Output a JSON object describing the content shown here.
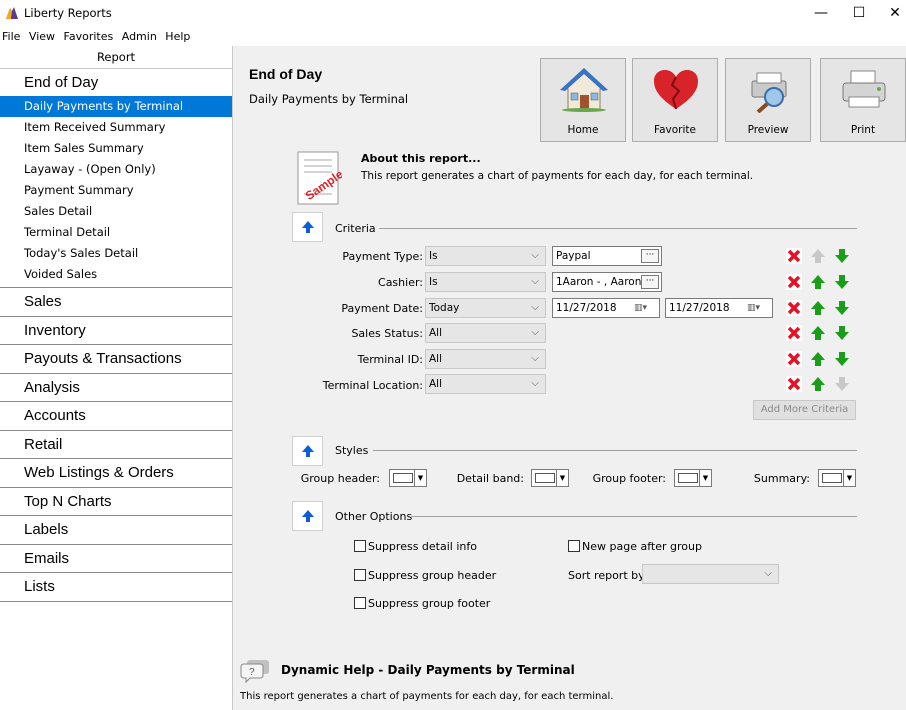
{
  "window": {
    "title": "Liberty Reports",
    "controls": [
      "—",
      "☐",
      "✕"
    ]
  },
  "menubar": [
    "File",
    "View",
    "Favorites",
    "Admin",
    "Help"
  ],
  "sidebar": {
    "header": "Report",
    "active_category": "End of Day",
    "sub_items": [
      "Daily Payments by Terminal",
      "Item Received Summary",
      "Item Sales Summary",
      "Layaway - (Open Only)",
      "Payment Summary",
      "Sales Detail",
      "Terminal Detail",
      "Today's Sales Detail",
      "Voided Sales"
    ],
    "categories": [
      "Sales",
      "Inventory",
      "Payouts & Transactions",
      "Analysis",
      "Accounts",
      "Retail",
      "Web Listings & Orders",
      "Top N Charts",
      "Labels",
      "Emails",
      "Lists"
    ]
  },
  "main": {
    "title": "End of Day",
    "subtitle": "Daily Payments by Terminal",
    "toolbar": {
      "home": "Home",
      "favorite": "Favorite",
      "preview": "Preview",
      "print": "Print"
    },
    "about": {
      "title": "About this report...",
      "description": "This report generates a chart of payments for each day, for each terminal.",
      "icon_text": "Sample"
    },
    "criteria": {
      "label": "Criteria",
      "rows": [
        {
          "label": "Payment Type:",
          "op": "Is",
          "value": "Paypal"
        },
        {
          "label": "Cashier:",
          "op": "Is",
          "value": "1Aaron - , Aaron"
        },
        {
          "label": "Payment Date:",
          "op": "Today",
          "from": "11/27/2018",
          "to": "11/27/2018"
        },
        {
          "label": "Sales Status:",
          "op": "All"
        },
        {
          "label": "Terminal ID:",
          "op": "All"
        },
        {
          "label": "Terminal Location:",
          "op": "All"
        }
      ],
      "add_more": "Add More Criteria"
    },
    "styles": {
      "label": "Styles",
      "group_header": "Group header:",
      "detail_band": "Detail band:",
      "group_footer": "Group footer:",
      "summary": "Summary:"
    },
    "options": {
      "label": "Other Options",
      "suppress_detail": "Suppress detail info",
      "suppress_group_header": "Suppress group header",
      "suppress_group_footer": "Suppress group footer",
      "new_page": "New page after group",
      "sort_by": "Sort report by:",
      "sort_value": ""
    },
    "help": {
      "title": "Dynamic Help - Daily Payments by Terminal",
      "description": "This report generates a chart of payments for each day, for each terminal."
    }
  },
  "colors": {
    "accent": "#0078d7",
    "remove": "#e81123",
    "arrow": "#1a9e1a",
    "arrow_disabled": "#c8c8c8"
  }
}
